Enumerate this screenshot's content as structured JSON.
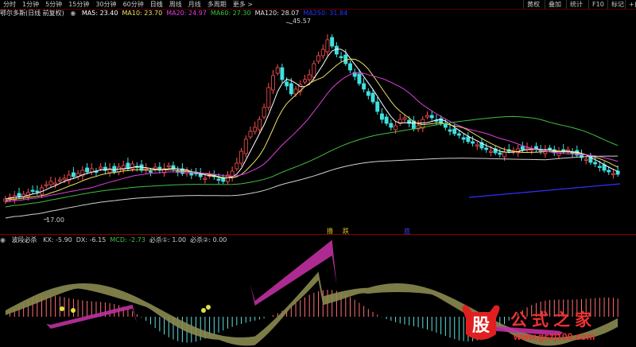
{
  "toolbar": {
    "periods": [
      "分时",
      "1分钟",
      "5分钟",
      "15分钟",
      "30分钟",
      "60分钟",
      "日线",
      "周线",
      "月线",
      "多周期",
      "更多 >"
    ],
    "active_period": "日线",
    "right_buttons": [
      "黄权",
      "叠加",
      "统计",
      "F10",
      "标记",
      "+自"
    ]
  },
  "main_legend": {
    "title": "鄂尔多斯(日线 前复权)",
    "items": [
      {
        "label": "MA5: 23.40",
        "color": "#ffffff"
      },
      {
        "label": "MA10: 23.70",
        "color": "#f0e060"
      },
      {
        "label": "MA20: 24.97",
        "color": "#e040e0"
      },
      {
        "label": "MA60: 27.30",
        "color": "#40c040"
      },
      {
        "label": "MA120: 28.07",
        "color": "#e0e0e0"
      },
      {
        "label": "MA250: 31.84",
        "color": "#3030ff"
      }
    ]
  },
  "price_labels": {
    "high": "45.57",
    "low": "17.00"
  },
  "signal_marks": [
    {
      "text": "撸",
      "color": "#e0c020"
    },
    {
      "text": "跌",
      "color": "#e0c020"
    },
    {
      "text": "底",
      "color": "#4040ff"
    }
  ],
  "indicator_legend": {
    "title": "波段必杀",
    "items": [
      {
        "label": "KX: -5.90",
        "color": "#cccccc"
      },
      {
        "label": "DX: -6.15",
        "color": "#cccccc"
      },
      {
        "label": "MCD: -2.73",
        "color": "#40c040"
      },
      {
        "label": "必杀①: 1.00",
        "color": "#cccccc"
      },
      {
        "label": "必杀②: 0.00",
        "color": "#cccccc"
      }
    ]
  },
  "watermark": {
    "text": "公式之家",
    "url": "www.gszj100.com",
    "mark": "股"
  },
  "colors": {
    "up": "#ff5050",
    "down": "#40e0e0",
    "bg": "#000000",
    "grid": "#8b0000"
  }
}
